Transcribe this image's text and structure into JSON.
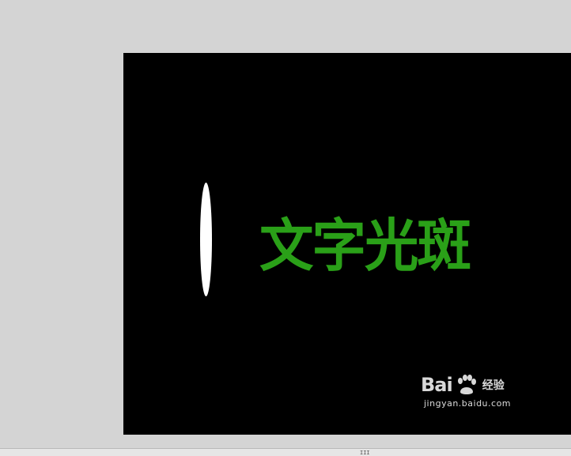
{
  "canvas": {
    "headline": "文字光斑",
    "headline_color": "#2aa018",
    "background_color": "#000000",
    "spot_color": "#ffffff"
  },
  "watermark": {
    "brand_left": "Bai",
    "brand_right": "经验",
    "url": "jingyan.baidu.com",
    "icon": "baidu-paw-icon"
  },
  "scrollbar": {
    "grip_label": "III"
  }
}
